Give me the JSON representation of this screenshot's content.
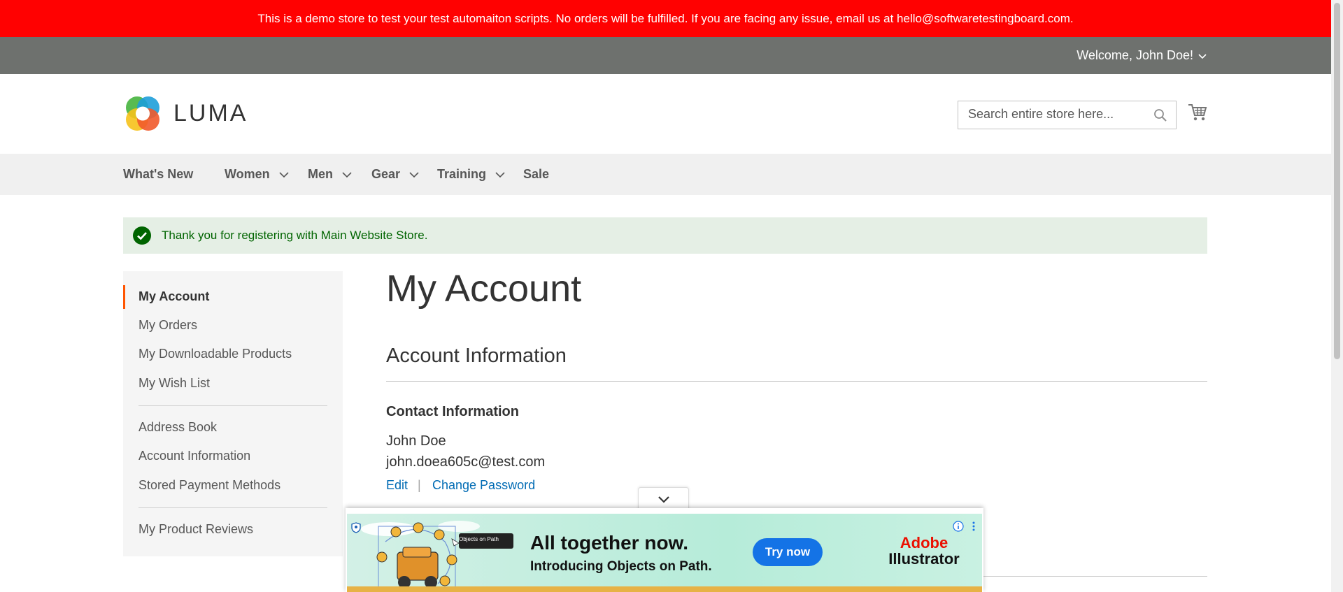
{
  "demo_banner": {
    "text": "This is a demo store to test your test automaiton scripts. No orders will be fulfilled. If you are facing any issue, email us at hello@softwaretestingboard.com."
  },
  "top_bar": {
    "welcome": "Welcome, John Doe!"
  },
  "header": {
    "logo_text": "LUMA",
    "search_placeholder": "Search entire store here..."
  },
  "nav": {
    "items": [
      {
        "label": "What's New"
      },
      {
        "label": "Women"
      },
      {
        "label": "Men"
      },
      {
        "label": "Gear"
      },
      {
        "label": "Training"
      },
      {
        "label": "Sale"
      }
    ]
  },
  "message": {
    "text": "Thank you for registering with Main Website Store."
  },
  "sidebar": {
    "items": [
      {
        "label": "My Account"
      },
      {
        "label": "My Orders"
      },
      {
        "label": "My Downloadable Products"
      },
      {
        "label": "My Wish List"
      },
      {
        "label": "Address Book"
      },
      {
        "label": "Account Information"
      },
      {
        "label": "Stored Payment Methods"
      },
      {
        "label": "My Product Reviews"
      }
    ]
  },
  "main": {
    "title": "My Account",
    "section_title": "Account Information",
    "contact": {
      "title": "Contact Information",
      "name": "John Doe",
      "email": "john.doea605c@test.com",
      "edit_label": "Edit",
      "separator": "|",
      "change_password_label": "Change Password"
    }
  },
  "ad": {
    "headline": "All together now.",
    "subline": "Introducing Objects on Path.",
    "cta": "Try now",
    "brand_line1": "Adobe",
    "brand_line2": "Illustrator",
    "art_label": "Objects on Path"
  },
  "colors": {
    "banner_red": "#ff0101",
    "top_bar_gray": "#6e716e",
    "nav_bg": "#f0f0f0",
    "accent_orange": "#ff5501",
    "link_blue": "#006bb4",
    "success_bg": "#e5efe5",
    "success_text": "#006400"
  }
}
